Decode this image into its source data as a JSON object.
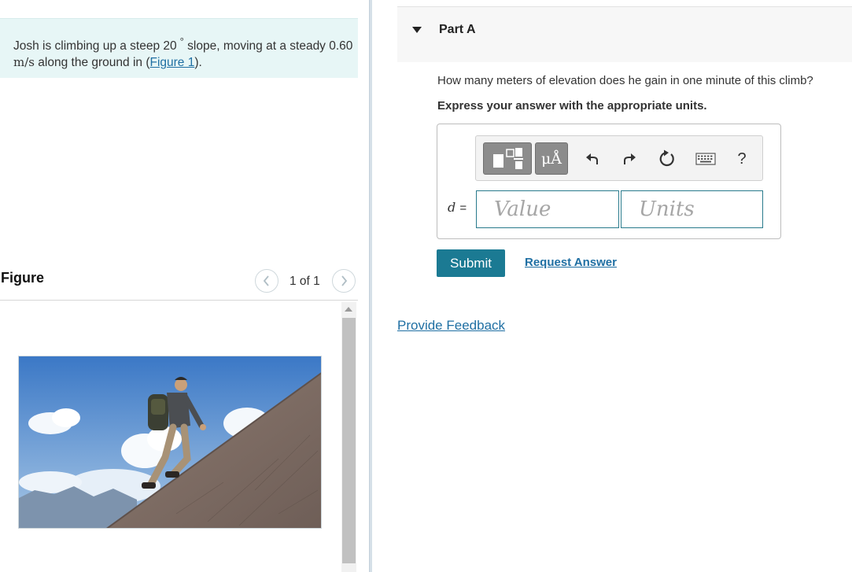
{
  "problem": {
    "text_before": "Josh is climbing up a steep 20",
    "degree_symbol": "°",
    "text_middle": " slope, moving at a steady 0.60 ",
    "speed_units": "m/s",
    "text_after": " along the ground in (",
    "figure_link": "Figure 1",
    "text_end": ")."
  },
  "figure": {
    "title": "Figure",
    "counter": "1 of 1",
    "prev_icon": "chevron-left-icon",
    "next_icon": "chevron-right-icon"
  },
  "part": {
    "title": "Part A",
    "collapse_icon": "caret-down-icon",
    "question": "How many meters of elevation does he gain in one minute of this climb?",
    "instruction": "Express your answer with the appropriate units."
  },
  "toolbar": {
    "units_label": "μÅ",
    "help_label": "?"
  },
  "answer": {
    "variable": "d",
    "equals": "=",
    "value_placeholder": "Value",
    "units_placeholder": "Units"
  },
  "actions": {
    "submit_label": "Submit",
    "request_answer_label": "Request Answer",
    "feedback_label": "Provide Feedback"
  },
  "colors": {
    "problem_bg": "#e7f6f6",
    "link": "#1f6fa3",
    "submit_bg": "#1b7a93",
    "input_border": "#287a8c"
  }
}
